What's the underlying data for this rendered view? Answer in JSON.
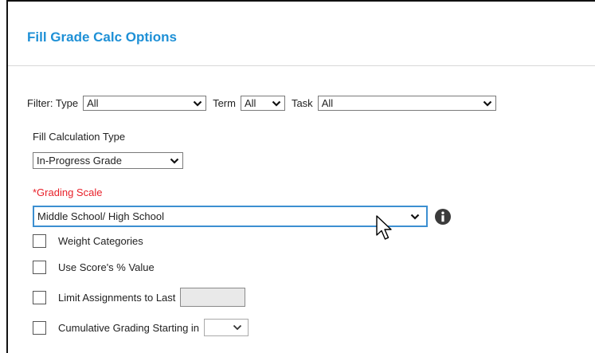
{
  "dialog": {
    "title": "Fill Grade Calc Options"
  },
  "filter": {
    "label": "Filter: Type",
    "type_value": "All",
    "term_label": "Term",
    "term_value": "All",
    "task_label": "Task",
    "task_value": "All"
  },
  "fill_calc": {
    "label": "Fill Calculation Type",
    "value": "In-Progress Grade"
  },
  "grading_scale": {
    "label": "*Grading Scale",
    "value": "Middle School/ High School"
  },
  "options": {
    "weight_categories": "Weight Categories",
    "use_score_pct": "Use Score's % Value",
    "limit_assignments": "Limit Assignments to Last",
    "cumulative_grading": "Cumulative Grading Starting in"
  },
  "colors": {
    "title": "#1e90d6",
    "required": "#e8212a",
    "focus_border": "#3c8fd1"
  }
}
